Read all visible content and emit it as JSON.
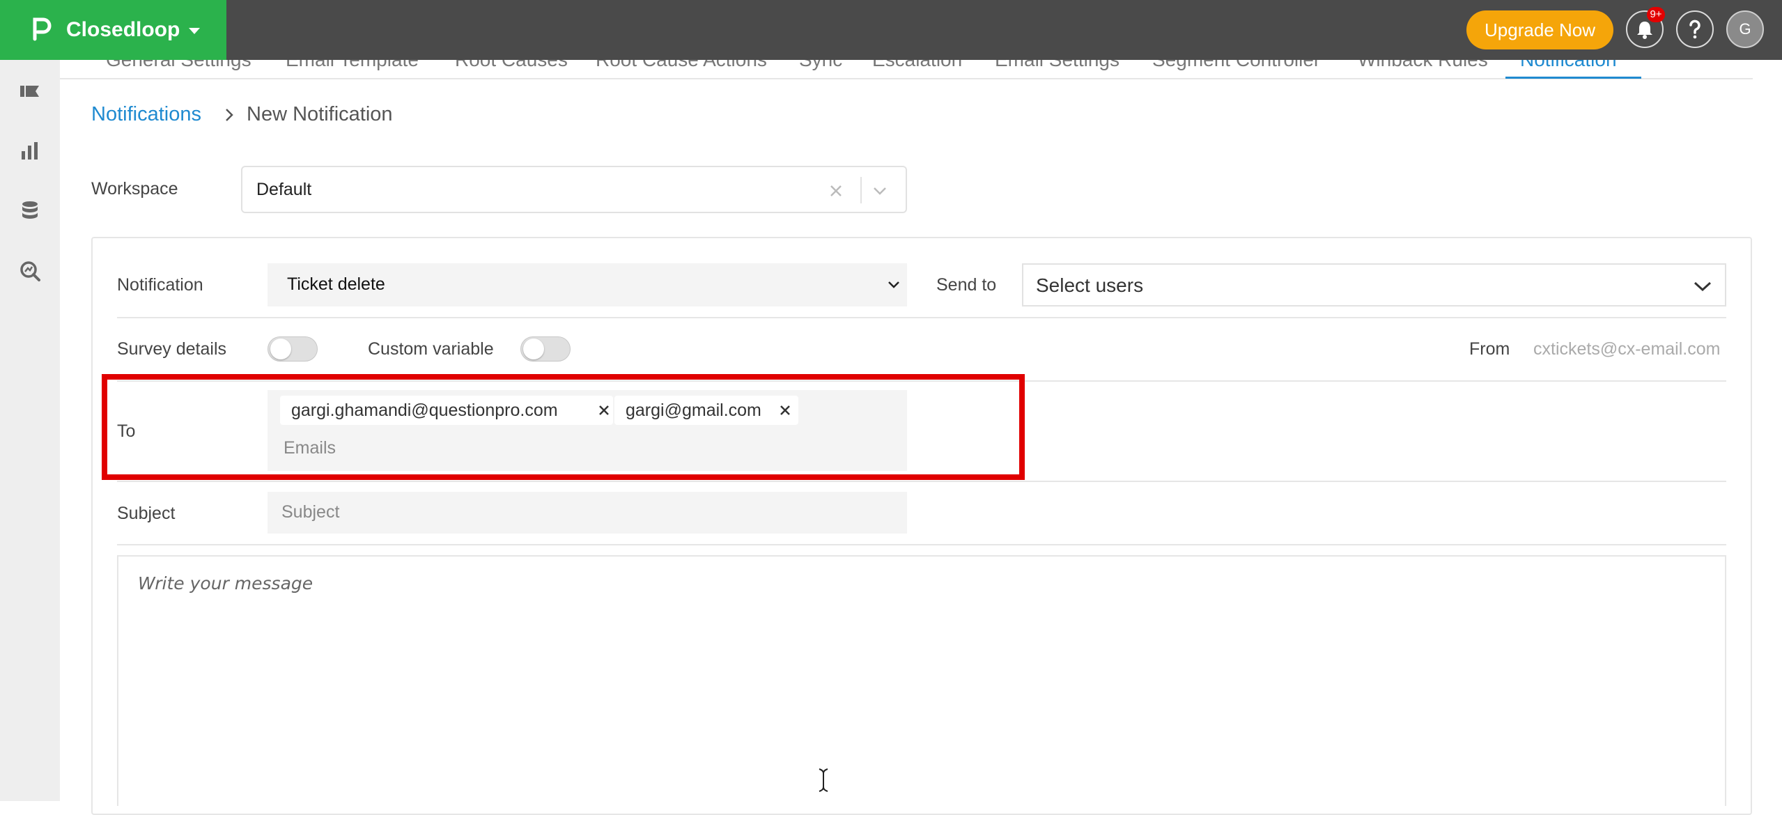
{
  "header": {
    "brand": "Closedloop",
    "upgrade_label": "Upgrade Now",
    "notifications_badge": "9+",
    "avatar_initial": "G"
  },
  "tabs": [
    {
      "label": "General Settings"
    },
    {
      "label": "Email Template"
    },
    {
      "label": "Root Causes"
    },
    {
      "label": "Root Cause Actions"
    },
    {
      "label": "Sync"
    },
    {
      "label": "Escalation"
    },
    {
      "label": "Email Settings"
    },
    {
      "label": "Segment Controller"
    },
    {
      "label": "Winback Rules"
    },
    {
      "label": "Notification",
      "active": true
    }
  ],
  "breadcrumb": {
    "parent": "Notifications",
    "current": "New Notification"
  },
  "workspace": {
    "label": "Workspace",
    "value": "Default"
  },
  "form": {
    "notification_label": "Notification",
    "notification_value": "Ticket delete",
    "send_to_label": "Send to",
    "send_to_placeholder": "Select users",
    "survey_details_label": "Survey details",
    "survey_details_on": false,
    "custom_variable_label": "Custom variable",
    "custom_variable_on": false,
    "from_label": "From",
    "from_value": "cxtickets@cx-email.com",
    "to_label": "To",
    "to_emails": [
      "gargi.ghamandi@questionpro.com",
      "gargi@gmail.com"
    ],
    "to_placeholder": "Emails",
    "subject_label": "Subject",
    "subject_placeholder": "Subject",
    "message_placeholder": "Write your message"
  },
  "colors": {
    "brand_green": "#2bb24c",
    "upgrade_orange": "#f5a50a",
    "link_blue": "#1f8ad0",
    "highlight_red": "#e00000"
  }
}
